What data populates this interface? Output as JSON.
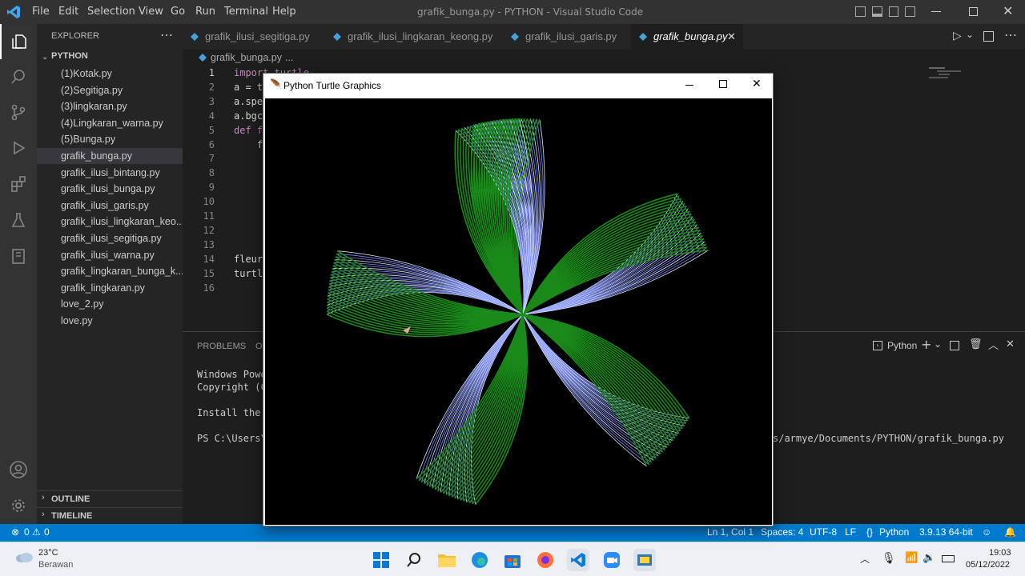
{
  "titlebar": {
    "menu": [
      "File",
      "Edit",
      "Selection",
      "View",
      "Go",
      "Run",
      "Terminal",
      "Help"
    ],
    "title": "grafik_bunga.py - PYTHON - Visual Studio Code"
  },
  "sidebar": {
    "header": "EXPLORER",
    "folder": "PYTHON",
    "files": [
      "(1)Kotak.py",
      "(2)Segitiga.py",
      "(3)lingkaran.py",
      "(4)Lingkaran_warna.py",
      "(5)Bunga.py",
      "grafik_bunga.py",
      "grafik_ilusi_bintang.py",
      "grafik_ilusi_bunga.py",
      "grafik_ilusi_garis.py",
      "grafik_ilusi_lingkaran_keo...",
      "grafik_ilusi_segitiga.py",
      "grafik_ilusi_warna.py",
      "grafik_lingkaran_bunga_k...",
      "grafik_lingkaran.py",
      "love_2.py",
      "love.py"
    ],
    "outline": "OUTLINE",
    "timeline": "TIMELINE"
  },
  "tabs": [
    "grafik_ilusi_segitiga.py",
    "grafik_ilusi_lingkaran_keong.py",
    "grafik_ilusi_garis.py",
    "grafik_bunga.py"
  ],
  "editor": {
    "breadcrumb_file": "grafik_bunga.py",
    "breadcrumb_more": "...",
    "line_numbers": [
      "1",
      "2",
      "3",
      "4",
      "5",
      "6",
      "7",
      "8",
      "9",
      "10",
      "11",
      "12",
      "13",
      "14",
      "15",
      "16"
    ],
    "lines": [
      "import turtle",
      "a = t",
      "a.spe",
      "a.bgc",
      "def f",
      "    f",
      "",
      "",
      "",
      "",
      "",
      "",
      "",
      "fleur",
      "turtl",
      ""
    ]
  },
  "panel": {
    "tabs": [
      "PROBLEMS",
      "O"
    ],
    "shell_label": "Python",
    "terminal": [
      "Windows Powe",
      "Copyright (C",
      "",
      "Install the l",
      "",
      "PS C:\\Users\\"
    ],
    "terminal_right": "s/armye/Documents/PYTHON/grafik_bunga.py"
  },
  "turtle": {
    "title": "Python Turtle Graphics"
  },
  "statusbar": {
    "errors": "0",
    "warnings": "0",
    "position": "Ln 1, Col 1",
    "spaces": "Spaces: 4",
    "encoding": "UTF-8",
    "eol": "LF",
    "language": "Python",
    "interpreter": "3.9.13 64-bit"
  },
  "taskbar": {
    "temp": "23°C",
    "weather": "Berawan",
    "time": "19:03",
    "date": "05/12/2022"
  },
  "colors": {
    "status": "#007acc",
    "petal_green": "#1a8a1a",
    "petal_blue": "#7b8cff",
    "accent": "#0078d4"
  }
}
